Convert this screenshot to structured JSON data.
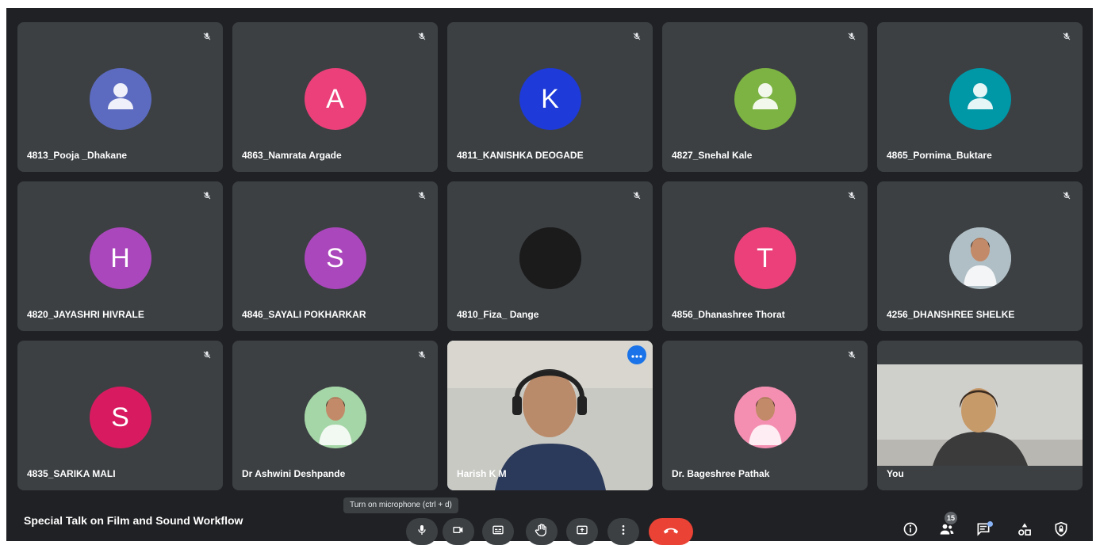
{
  "participants": [
    {
      "name": "4813_Pooja _Dhakane",
      "avatar_color": "#5c6bc0",
      "initial": "",
      "type": "person-icon"
    },
    {
      "name": "4863_Namrata Argade",
      "avatar_color": "#ec407a",
      "initial": "A",
      "type": "initial"
    },
    {
      "name": "4811_KANISHKA DEOGADE",
      "avatar_color": "#1e3ad8",
      "initial": "K",
      "type": "initial"
    },
    {
      "name": "4827_Snehal Kale",
      "avatar_color": "#7cb342",
      "initial": "",
      "type": "person-icon"
    },
    {
      "name": "4865_Pornima_Buktare",
      "avatar_color": "#0097a7",
      "initial": "",
      "type": "person-icon"
    },
    {
      "name": "4820_JAYASHRI HIVRALE",
      "avatar_color": "#ab47bc",
      "initial": "H",
      "type": "initial"
    },
    {
      "name": "4846_SAYALI POKHARKAR",
      "avatar_color": "#ab47bc",
      "initial": "S",
      "type": "initial"
    },
    {
      "name": "4810_Fiza_ Dange",
      "avatar_color": "#1b1b1b",
      "initial": "",
      "type": "photo"
    },
    {
      "name": "4856_Dhanashree Thorat",
      "avatar_color": "#ec407a",
      "initial": "T",
      "type": "initial"
    },
    {
      "name": "4256_DHANSHREE SHELKE",
      "avatar_color": "#b0bec5",
      "initial": "",
      "type": "photo"
    },
    {
      "name": "4835_SARIKA MALI",
      "avatar_color": "#d81b60",
      "initial": "S",
      "type": "initial"
    },
    {
      "name": "Dr Ashwini Deshpande",
      "avatar_color": "#a5d6a7",
      "initial": "",
      "type": "photo"
    },
    {
      "name": "Harish K M",
      "avatar_color": "#9e9e9e",
      "initial": "",
      "type": "video"
    },
    {
      "name": "Dr. Bageshree Pathak",
      "avatar_color": "#f48fb1",
      "initial": "",
      "type": "photo"
    },
    {
      "name": "You",
      "avatar_color": "#d7ccc8",
      "initial": "",
      "type": "self-video"
    }
  ],
  "meeting": {
    "title": "Special Talk on Film and Sound Workflow",
    "tooltip": "Turn on microphone (ctrl + d)",
    "participant_count": "15"
  },
  "colors": {
    "background": "#202124",
    "tile": "#3c4043",
    "accent": "#8ab4f8",
    "hangup": "#ea4335"
  },
  "controls": [
    "mic-icon",
    "camera-icon",
    "captions-icon",
    "raise-hand-icon",
    "present-icon",
    "more-options-icon",
    "hangup-icon"
  ],
  "right_controls": [
    "info-icon",
    "people-icon",
    "chat-icon",
    "activities-icon",
    "host-controls-icon"
  ]
}
